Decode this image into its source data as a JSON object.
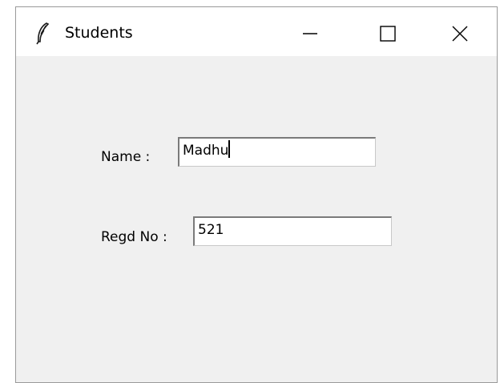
{
  "window": {
    "title": "Students",
    "controls": {
      "minimize_icon": "minimize-icon",
      "maximize_icon": "maximize-icon",
      "close_icon": "close-icon"
    }
  },
  "form": {
    "name_label": "Name :",
    "name_value": "Madhu",
    "regd_label": "Regd No :",
    "regd_value": "521"
  },
  "colors": {
    "titlebar": "#ffffff",
    "client_area": "#f0f0f0",
    "entry_background": "#ffffff"
  }
}
